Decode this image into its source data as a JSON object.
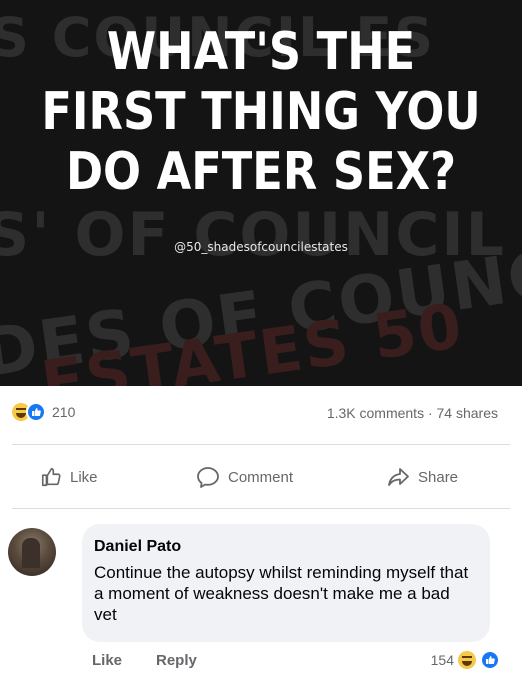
{
  "post": {
    "meme_lines": [
      "WHAT'S THE",
      "FIRST THING YOU",
      "DO AFTER SEX?"
    ],
    "handle": "@50_shadesofcouncilestates",
    "reaction_count": "210",
    "counts_text": "1.3K comments · 74 shares"
  },
  "actions": {
    "like": "Like",
    "comment": "Comment",
    "share": "Share"
  },
  "comment": {
    "author": "Daniel Pato",
    "text": "Continue the autopsy whilst reminding myself that a moment of weakness doesn't make me a bad vet",
    "like": "Like",
    "reply": "Reply",
    "reaction_count": "154"
  },
  "icons": [
    "haha-emoji-icon",
    "like-reaction-icon",
    "thumbs-up-icon",
    "speech-bubble-icon",
    "share-arrow-icon"
  ],
  "colors": {
    "facebook_blue": "#1877f2",
    "secondary_text": "#65676b",
    "bubble_bg": "#f0f2f5",
    "meme_bg": "#141414"
  }
}
